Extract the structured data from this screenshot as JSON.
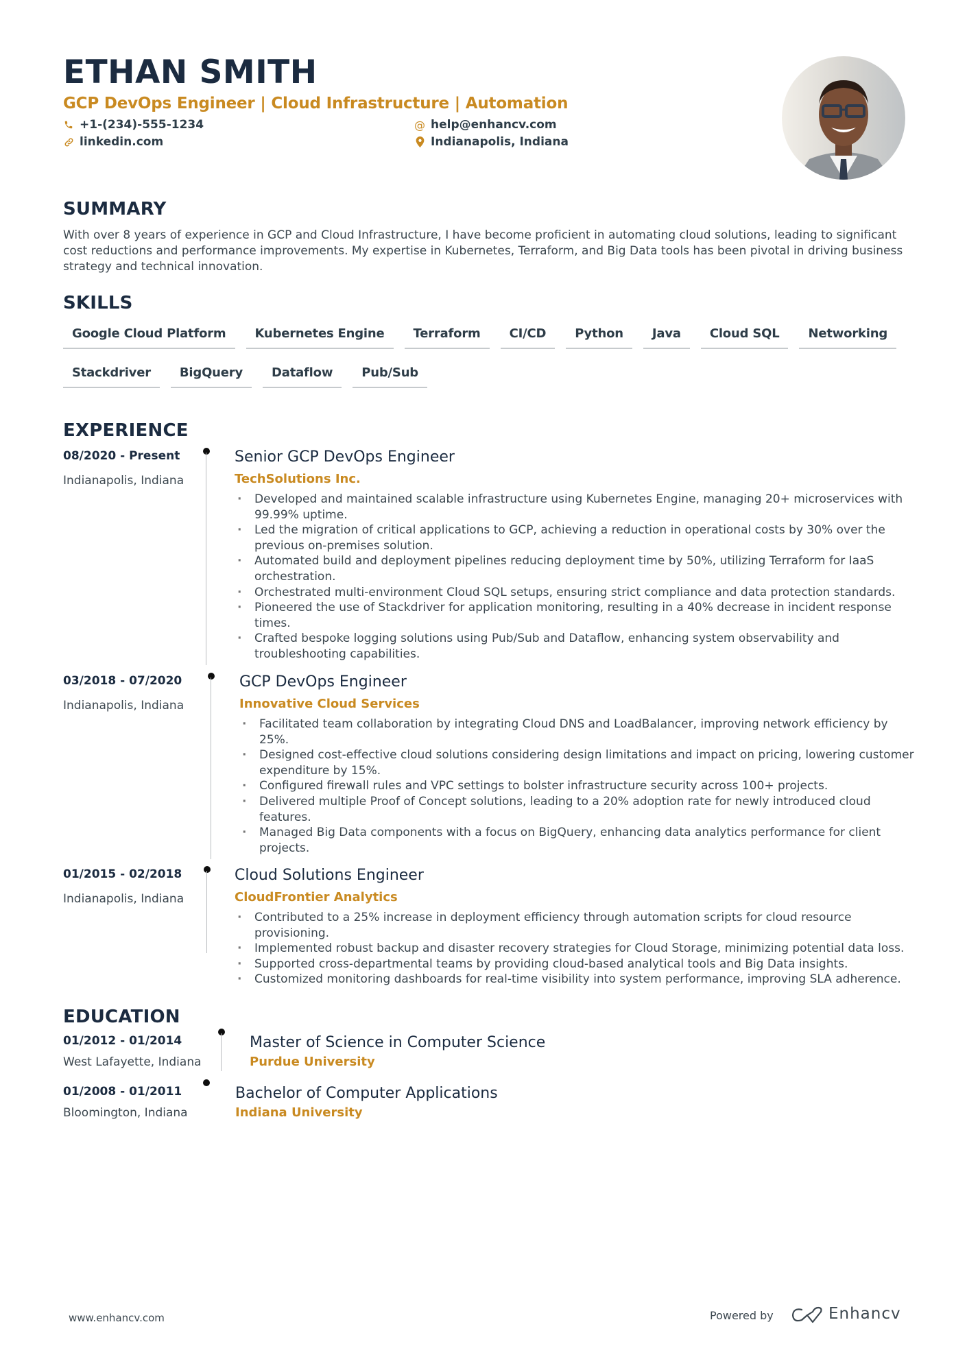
{
  "header": {
    "name": "ETHAN SMITH",
    "headline": "GCP DevOps Engineer | Cloud Infrastructure | Automation",
    "contacts": {
      "phone": {
        "icon": "phone-icon",
        "value": "+1-(234)-555-1234"
      },
      "email": {
        "icon": "at-icon",
        "value": "help@enhancv.com"
      },
      "link": {
        "icon": "link-icon",
        "value": "linkedin.com"
      },
      "location": {
        "icon": "location-pin-icon",
        "value": "Indianapolis, Indiana"
      }
    }
  },
  "summary": {
    "title": "SUMMARY",
    "text": "With over 8 years of experience in GCP and Cloud Infrastructure, I have become proficient in automating cloud solutions, leading to significant cost reductions and performance improvements. My expertise in Kubernetes, Terraform, and Big Data tools has been pivotal in driving business strategy and technical innovation."
  },
  "skills": {
    "title": "SKILLS",
    "items": [
      "Google Cloud Platform",
      "Kubernetes Engine",
      "Terraform",
      "CI/CD",
      "Python",
      "Java",
      "Cloud SQL",
      "Networking",
      "Stackdriver",
      "BigQuery",
      "Dataflow",
      "Pub/Sub"
    ]
  },
  "experience": {
    "title": "EXPERIENCE",
    "jobs": [
      {
        "dates": "08/2020 - Present",
        "location": "Indianapolis, Indiana",
        "title": "Senior GCP DevOps Engineer",
        "company": "TechSolutions Inc.",
        "bullets": [
          "Developed and maintained scalable infrastructure using Kubernetes Engine, managing 20+ microservices with 99.99% uptime.",
          "Led the migration of critical applications to GCP, achieving a reduction in operational costs by 30% over the previous on-premises solution.",
          "Automated build and deployment pipelines reducing deployment time by 50%, utilizing Terraform for IaaS orchestration.",
          "Orchestrated multi-environment Cloud SQL setups, ensuring strict compliance and data protection standards.",
          "Pioneered the use of Stackdriver for application monitoring, resulting in a 40% decrease in incident response times.",
          "Crafted bespoke logging solutions using Pub/Sub and Dataflow, enhancing system observability and troubleshooting capabilities."
        ]
      },
      {
        "dates": "03/2018 - 07/2020",
        "location": "Indianapolis, Indiana",
        "title": "GCP DevOps Engineer",
        "company": "Innovative Cloud Services",
        "bullets": [
          "Facilitated team collaboration by integrating Cloud DNS and LoadBalancer, improving network efficiency by 25%.",
          "Designed cost-effective cloud solutions considering design limitations and impact on pricing, lowering customer expenditure by 15%.",
          "Configured firewall rules and VPC settings to bolster infrastructure security across 100+ projects.",
          "Delivered multiple Proof of Concept solutions, leading to a 20% adoption rate for newly introduced cloud features.",
          "Managed Big Data components with a focus on BigQuery, enhancing data analytics performance for client projects."
        ]
      },
      {
        "dates": "01/2015 - 02/2018",
        "location": "Indianapolis, Indiana",
        "title": "Cloud Solutions Engineer",
        "company": "CloudFrontier Analytics",
        "bullets": [
          "Contributed to a 25% increase in deployment efficiency through automation scripts for cloud resource provisioning.",
          "Implemented robust backup and disaster recovery strategies for Cloud Storage, minimizing potential data loss.",
          "Supported cross-departmental teams by providing cloud-based analytical tools and Big Data insights.",
          "Customized monitoring dashboards for real-time visibility into system performance, improving SLA adherence."
        ]
      }
    ]
  },
  "education": {
    "title": "EDUCATION",
    "items": [
      {
        "dates": "01/2012 - 01/2014",
        "location": "West Lafayette, Indiana",
        "degree": "Master of Science in Computer Science",
        "school": "Purdue University"
      },
      {
        "dates": "01/2008 - 01/2011",
        "location": "Bloomington, Indiana",
        "degree": "Bachelor of Computer Applications",
        "school": "Indiana University"
      }
    ]
  },
  "footer": {
    "url": "www.enhancv.com",
    "powered_by": "Powered by",
    "brand": "Enhancv"
  },
  "colors": {
    "accent": "#c98a21",
    "heading": "#1b2b40",
    "text": "#3c474f"
  }
}
